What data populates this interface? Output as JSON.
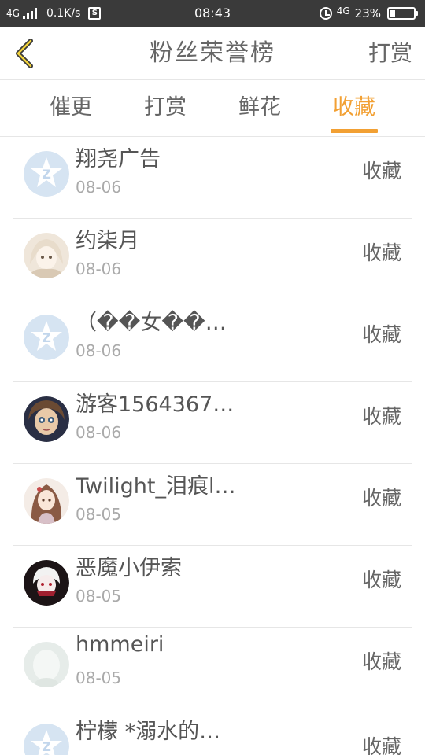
{
  "status_bar": {
    "network": "4G",
    "speed": "0.1K/s",
    "time": "08:43",
    "network_right": "4G",
    "battery": "23%",
    "battery_level": 0.23
  },
  "header": {
    "title": "粉丝荣誉榜",
    "action": "打赏"
  },
  "tabs": [
    {
      "label": "催更",
      "active": false
    },
    {
      "label": "打赏",
      "active": false
    },
    {
      "label": "鲜花",
      "active": false
    },
    {
      "label": "收藏",
      "active": true
    }
  ],
  "colors": {
    "accent": "#f2a033",
    "status_bar": "#3a3a3a"
  },
  "list": [
    {
      "name": "翔尧广告",
      "date": "08-06",
      "action": "收藏",
      "avatar": "qq-default-avatar"
    },
    {
      "name": "约柒月",
      "date": "08-06",
      "action": "收藏",
      "avatar": "anime-girl-avatar"
    },
    {
      "name": "（��女��…",
      "date": "08-06",
      "action": "收藏",
      "avatar": "qq-default-avatar"
    },
    {
      "name": "游客1564367…",
      "date": "08-06",
      "action": "收藏",
      "avatar": "doll-avatar"
    },
    {
      "name": "Twilight_泪痕l…",
      "date": "08-05",
      "action": "收藏",
      "avatar": "anime-girl-avatar"
    },
    {
      "name": "恶魔小伊索",
      "date": "08-05",
      "action": "收藏",
      "avatar": "dark-character-avatar"
    },
    {
      "name": "hmmeiri",
      "date": "08-05",
      "action": "收藏",
      "avatar": "blank-avatar"
    },
    {
      "name": "柠檬 *溺水的…",
      "date": "",
      "action": "收藏",
      "avatar": "qq-default-avatar"
    }
  ]
}
